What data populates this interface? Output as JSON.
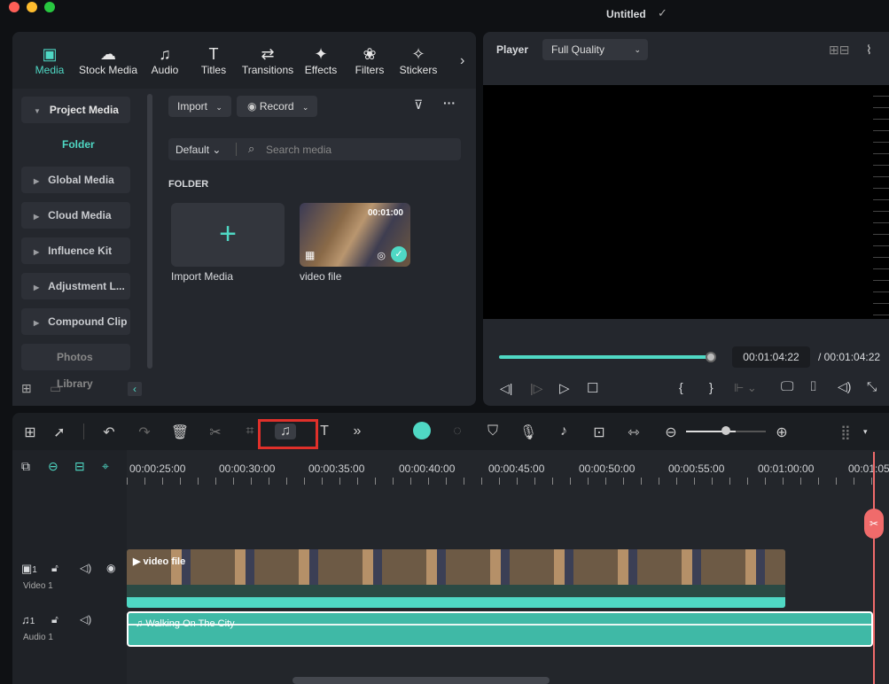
{
  "window": {
    "title": "Untitled",
    "saved_icon": "check-circle-icon"
  },
  "media_tabs": [
    {
      "label": "Media",
      "icon": "▣"
    },
    {
      "label": "Stock Media",
      "icon": "☁"
    },
    {
      "label": "Audio",
      "icon": "♫"
    },
    {
      "label": "Titles",
      "icon": "T"
    },
    {
      "label": "Transitions",
      "icon": "⇄"
    },
    {
      "label": "Effects",
      "icon": "✦"
    },
    {
      "label": "Filters",
      "icon": "❀"
    },
    {
      "label": "Stickers",
      "icon": "✧"
    }
  ],
  "sidebar": {
    "project_media": "Project Media",
    "folder": "Folder",
    "items": [
      "Global Media",
      "Cloud Media",
      "Influence Kit",
      "Adjustment L...",
      "Compound Clip"
    ],
    "photos": "Photos Library"
  },
  "media": {
    "import": "Import",
    "record": "Record",
    "sort": "Default",
    "search_placeholder": "Search media",
    "section": "FOLDER",
    "import_media": "Import Media",
    "clip_name": "video file",
    "clip_duration": "00:01:00"
  },
  "player": {
    "label": "Player",
    "quality": "Full Quality",
    "current_time": "00:01:04:22",
    "total_time": "/ 00:01:04:22",
    "progress": 1.0
  },
  "timeline": {
    "ticks": [
      "00:00:25:00",
      "00:00:30:00",
      "00:00:35:00",
      "00:00:40:00",
      "00:00:45:00",
      "00:00:50:00",
      "00:00:55:00",
      "00:01:00:00",
      "00:01:05"
    ],
    "video_track": {
      "label": "Video 1",
      "index": "1",
      "clip": "video file"
    },
    "audio_track": {
      "label": "Audio 1",
      "index": "1",
      "clip": "Walking On The City"
    },
    "accent": "#4fd8c4",
    "highlight": "#e0302a",
    "playhead": "#f06b6b",
    "zoom_level": 0.62
  }
}
